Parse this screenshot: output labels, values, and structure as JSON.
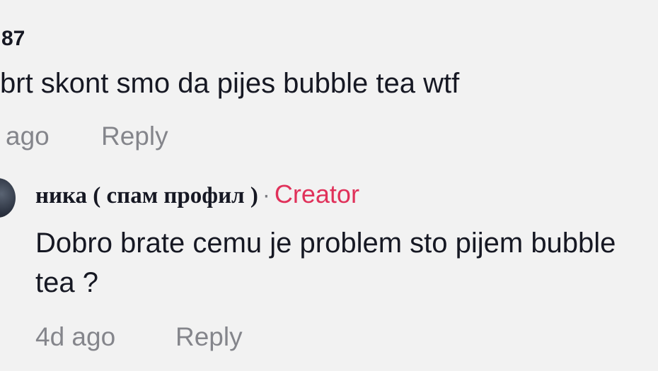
{
  "parent_comment": {
    "username_partial": "87",
    "text": "brt skont smo da pijes bubble tea wtf",
    "time": "ago",
    "reply_label": "Reply"
  },
  "reply": {
    "author": "ника ( спам профил )",
    "separator": "·",
    "badge": "Creator",
    "text": "Dobro brate cemu je problem sto pijem bubble tea ?",
    "time": "4d ago",
    "reply_label": "Reply"
  },
  "colors": {
    "background": "#f2f2f2",
    "text": "#161823",
    "muted": "#8a8b91",
    "creator_badge": "#e0315a"
  }
}
